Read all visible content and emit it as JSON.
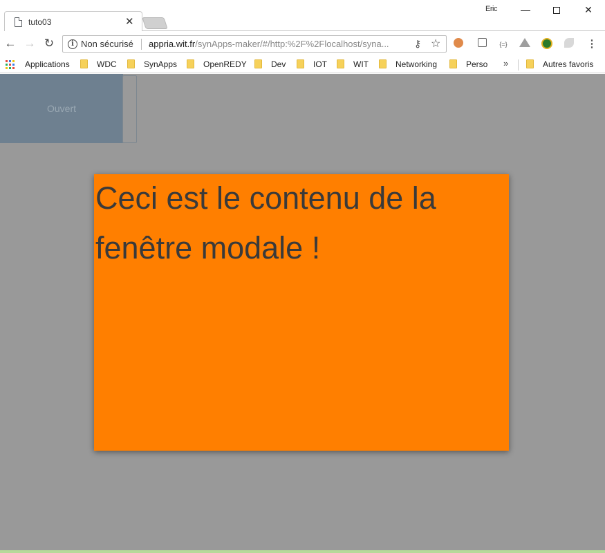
{
  "window": {
    "tab_title": "tuto03",
    "tab_close": "✕",
    "user_label": "Eric",
    "minimize": "—",
    "close": "✕"
  },
  "toolbar": {
    "back": "←",
    "forward": "→",
    "reload": "↻",
    "security_label": "Non sécurisé",
    "url_host": "appria.wit.fr",
    "url_rest": "/synApps-maker/#/http:%2F%2Flocalhost/syna...",
    "star": "☆",
    "key": "⚷",
    "ext_json": "{=}",
    "menu": "⋮"
  },
  "bookmarks": {
    "apps_label": "Applications",
    "items": [
      "WDC",
      "SynApps",
      "OpenREDY",
      "Dev",
      "IOT",
      "WIT",
      "Networking",
      "Perso"
    ],
    "more": "»",
    "other": "Autres favoris"
  },
  "page": {
    "open_button_label": "Ouvert",
    "modal_text": "Ceci est le contenu de la fenêtre modale !"
  },
  "colors": {
    "page_background": "#999999",
    "modal_background": "#ff7f00",
    "button_background": "#6e8090"
  }
}
